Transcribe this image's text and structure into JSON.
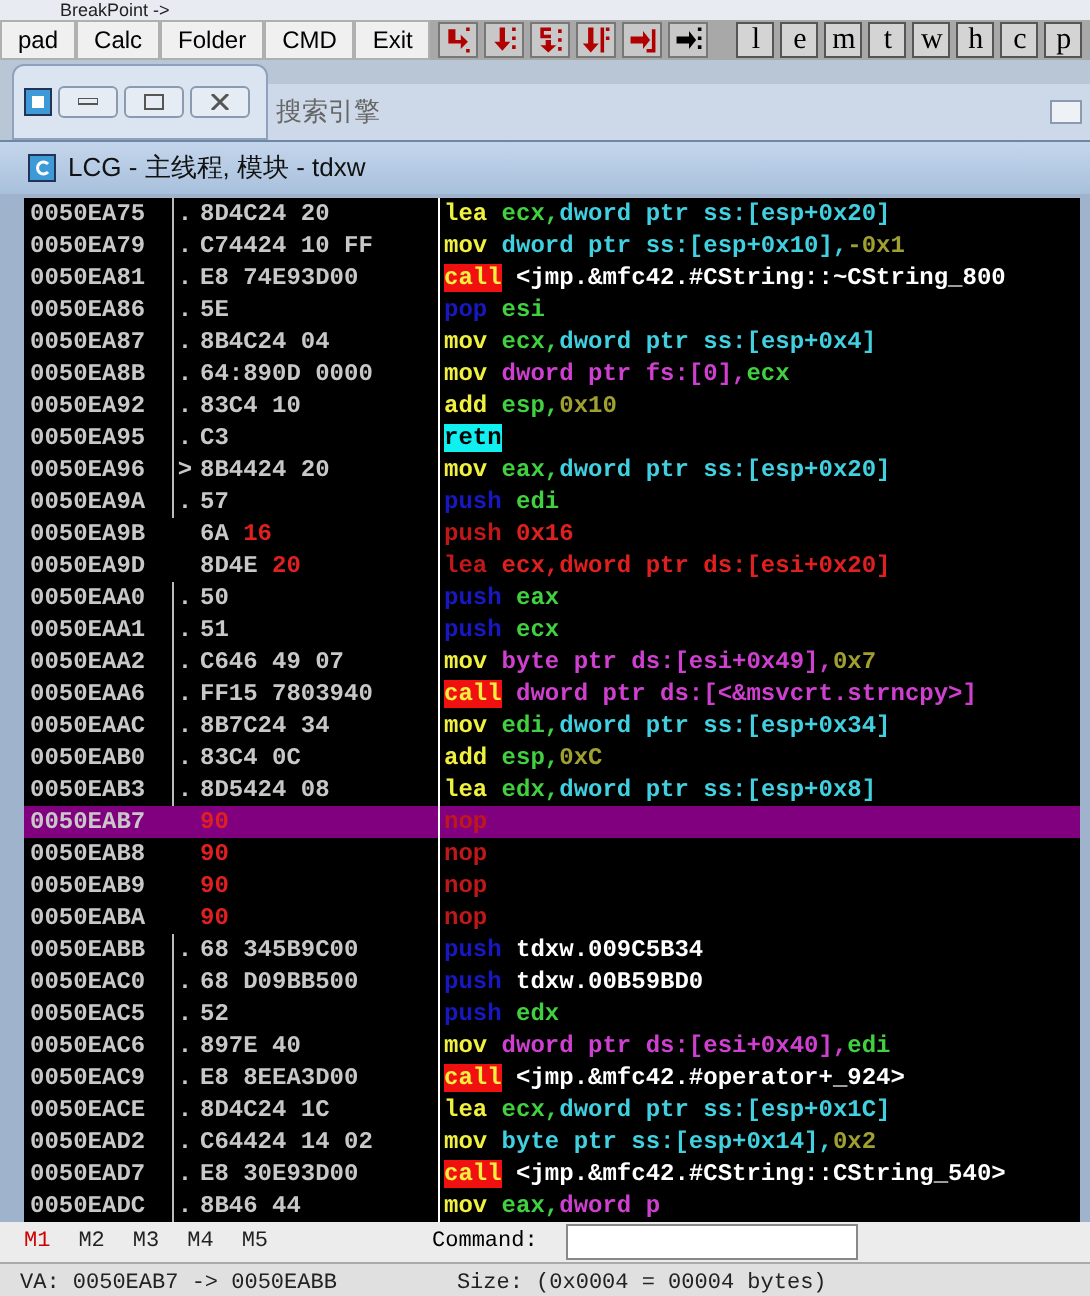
{
  "top_strip": {
    "text": "BreakPoint ->"
  },
  "toolbar": {
    "buttons": [
      "pad",
      "Calc",
      "Folder",
      "CMD",
      "Exit"
    ],
    "letter_buttons": [
      "l",
      "e",
      "m",
      "t",
      "w",
      "h",
      "c",
      "p"
    ]
  },
  "background_window": {
    "title": "搜索引擎"
  },
  "window": {
    "title": "LCG -  主线程, 模块 - tdxw"
  },
  "rows": [
    {
      "address": "0050EA75",
      "marker": ".",
      "bracket": true,
      "selected": false,
      "hex": [
        {
          "text": "8D4C24 20",
          "kind": "plain"
        }
      ],
      "asm": [
        {
          "text": "lea",
          "kind": "op"
        },
        {
          "text": " ecx,",
          "kind": "reg"
        },
        {
          "text": "dword ptr ss:[esp+0x20]",
          "kind": "mem"
        }
      ]
    },
    {
      "address": "0050EA79",
      "marker": ".",
      "bracket": true,
      "selected": false,
      "hex": [
        {
          "text": "C74424 10 FF",
          "kind": "plain"
        }
      ],
      "asm": [
        {
          "text": "mov",
          "kind": "op"
        },
        {
          "text": " dword ptr ss:[esp+0x10],",
          "kind": "mem"
        },
        {
          "text": "-0x1",
          "kind": "imm"
        }
      ]
    },
    {
      "address": "0050EA81",
      "marker": ".",
      "bracket": true,
      "selected": false,
      "hex": [
        {
          "text": "E8 74E93D00",
          "kind": "plain"
        }
      ],
      "asm": [
        {
          "text": "call",
          "kind": "call"
        },
        {
          "text": " <jmp.&mfc42.#CString::~CString_800",
          "kind": "sym"
        }
      ]
    },
    {
      "address": "0050EA86",
      "marker": ".",
      "bracket": true,
      "selected": false,
      "hex": [
        {
          "text": "5E",
          "kind": "plain"
        }
      ],
      "asm": [
        {
          "text": "pop",
          "kind": "stack"
        },
        {
          "text": " esi",
          "kind": "reg"
        }
      ]
    },
    {
      "address": "0050EA87",
      "marker": ".",
      "bracket": true,
      "selected": false,
      "hex": [
        {
          "text": "8B4C24 04",
          "kind": "plain"
        }
      ],
      "asm": [
        {
          "text": "mov",
          "kind": "op"
        },
        {
          "text": " ecx,",
          "kind": "reg"
        },
        {
          "text": "dword ptr ss:[esp+0x4]",
          "kind": "mem"
        }
      ]
    },
    {
      "address": "0050EA8B",
      "marker": ".",
      "bracket": true,
      "selected": false,
      "hex": [
        {
          "text": "64:890D 0000",
          "kind": "plain"
        }
      ],
      "asm": [
        {
          "text": "mov",
          "kind": "op"
        },
        {
          "text": " dword ptr fs:[0],",
          "kind": "memw"
        },
        {
          "text": "ecx",
          "kind": "reg"
        }
      ]
    },
    {
      "address": "0050EA92",
      "marker": ".",
      "bracket": true,
      "selected": false,
      "hex": [
        {
          "text": "83C4 10",
          "kind": "plain"
        }
      ],
      "asm": [
        {
          "text": "add",
          "kind": "op"
        },
        {
          "text": " esp,",
          "kind": "reg"
        },
        {
          "text": "0x10",
          "kind": "imm"
        }
      ]
    },
    {
      "address": "0050EA95",
      "marker": ".",
      "bracket": true,
      "selected": false,
      "hex": [
        {
          "text": "C3",
          "kind": "plain"
        }
      ],
      "asm": [
        {
          "text": "retn",
          "kind": "retn"
        }
      ]
    },
    {
      "address": "0050EA96",
      "marker": ">",
      "bracket": true,
      "selected": false,
      "hex": [
        {
          "text": "8B4424 20",
          "kind": "plain"
        }
      ],
      "asm": [
        {
          "text": "mov",
          "kind": "op"
        },
        {
          "text": " eax,",
          "kind": "reg"
        },
        {
          "text": "dword ptr ss:[esp+0x20]",
          "kind": "mem"
        }
      ]
    },
    {
      "address": "0050EA9A",
      "marker": ".",
      "bracket": true,
      "selected": false,
      "hex": [
        {
          "text": "57",
          "kind": "plain"
        }
      ],
      "asm": [
        {
          "text": "push",
          "kind": "stack"
        },
        {
          "text": " edi",
          "kind": "reg"
        }
      ]
    },
    {
      "address": "0050EA9B",
      "bracket": false,
      "selected": false,
      "hex": [
        {
          "text": "6A ",
          "kind": "plain"
        },
        {
          "text": "16",
          "kind": "red"
        }
      ],
      "asm": [
        {
          "text": "push",
          "kind": "dead"
        },
        {
          "text": " 0x16",
          "kind": "red"
        }
      ]
    },
    {
      "address": "0050EA9D",
      "bracket": false,
      "selected": false,
      "hex": [
        {
          "text": "8D4E ",
          "kind": "plain"
        },
        {
          "text": "20",
          "kind": "red"
        }
      ],
      "asm": [
        {
          "text": "lea",
          "kind": "dead"
        },
        {
          "text": " ecx,dword ptr ds:[esi+0x20]",
          "kind": "red"
        }
      ]
    },
    {
      "address": "0050EAA0",
      "marker": ".",
      "bracket": true,
      "selected": false,
      "hex": [
        {
          "text": "50",
          "kind": "plain"
        }
      ],
      "asm": [
        {
          "text": "push",
          "kind": "stack"
        },
        {
          "text": " eax",
          "kind": "reg"
        }
      ]
    },
    {
      "address": "0050EAA1",
      "marker": ".",
      "bracket": true,
      "selected": false,
      "hex": [
        {
          "text": "51",
          "kind": "plain"
        }
      ],
      "asm": [
        {
          "text": "push",
          "kind": "stack"
        },
        {
          "text": " ecx",
          "kind": "reg"
        }
      ]
    },
    {
      "address": "0050EAA2",
      "marker": ".",
      "bracket": true,
      "selected": false,
      "hex": [
        {
          "text": "C646 49 07",
          "kind": "plain"
        }
      ],
      "asm": [
        {
          "text": "mov",
          "kind": "op"
        },
        {
          "text": " byte ptr ds:[esi+0x49],",
          "kind": "memw"
        },
        {
          "text": "0x7",
          "kind": "imm"
        }
      ]
    },
    {
      "address": "0050EAA6",
      "marker": ".",
      "bracket": true,
      "selected": false,
      "hex": [
        {
          "text": "FF15 7803940",
          "kind": "plain"
        }
      ],
      "asm": [
        {
          "text": "call",
          "kind": "call"
        },
        {
          "text": " dword ptr ds:[<&msvcrt.strncpy>]",
          "kind": "memw"
        }
      ]
    },
    {
      "address": "0050EAAC",
      "marker": ".",
      "bracket": true,
      "selected": false,
      "hex": [
        {
          "text": "8B7C24 34",
          "kind": "plain"
        }
      ],
      "asm": [
        {
          "text": "mov",
          "kind": "op"
        },
        {
          "text": " edi,",
          "kind": "reg"
        },
        {
          "text": "dword ptr ss:[esp+0x34]",
          "kind": "mem"
        }
      ]
    },
    {
      "address": "0050EAB0",
      "marker": ".",
      "bracket": true,
      "selected": false,
      "hex": [
        {
          "text": "83C4 0C",
          "kind": "plain"
        }
      ],
      "asm": [
        {
          "text": "add",
          "kind": "op"
        },
        {
          "text": " esp,",
          "kind": "reg"
        },
        {
          "text": "0xC",
          "kind": "imm"
        }
      ]
    },
    {
      "address": "0050EAB3",
      "marker": ".",
      "bracket": true,
      "selected": false,
      "hex": [
        {
          "text": "8D5424 08",
          "kind": "plain"
        }
      ],
      "asm": [
        {
          "text": "lea",
          "kind": "op"
        },
        {
          "text": " edx,",
          "kind": "reg"
        },
        {
          "text": "dword ptr ss:[esp+0x8]",
          "kind": "mem"
        }
      ]
    },
    {
      "address": "0050EAB7",
      "bracket": false,
      "selected": true,
      "hex": [
        {
          "text": "90",
          "kind": "red"
        }
      ],
      "asm": [
        {
          "text": "nop",
          "kind": "dead"
        }
      ]
    },
    {
      "address": "0050EAB8",
      "bracket": false,
      "selected": false,
      "hex": [
        {
          "text": "90",
          "kind": "red"
        }
      ],
      "asm": [
        {
          "text": "nop",
          "kind": "dead"
        }
      ]
    },
    {
      "address": "0050EAB9",
      "bracket": false,
      "selected": false,
      "hex": [
        {
          "text": "90",
          "kind": "red"
        }
      ],
      "asm": [
        {
          "text": "nop",
          "kind": "dead"
        }
      ]
    },
    {
      "address": "0050EABA",
      "bracket": false,
      "selected": false,
      "hex": [
        {
          "text": "90",
          "kind": "red"
        }
      ],
      "asm": [
        {
          "text": "nop",
          "kind": "dead"
        }
      ]
    },
    {
      "address": "0050EABB",
      "marker": ".",
      "bracket": true,
      "selected": false,
      "hex": [
        {
          "text": "68 345B9C00",
          "kind": "plain"
        }
      ],
      "asm": [
        {
          "text": "push",
          "kind": "stack"
        },
        {
          "text": " tdxw.009C5B34",
          "kind": "sym"
        }
      ]
    },
    {
      "address": "0050EAC0",
      "marker": ".",
      "bracket": true,
      "selected": false,
      "hex": [
        {
          "text": "68 D09BB500",
          "kind": "plain"
        }
      ],
      "asm": [
        {
          "text": "push",
          "kind": "stack"
        },
        {
          "text": " tdxw.00B59BD0",
          "kind": "sym"
        }
      ]
    },
    {
      "address": "0050EAC5",
      "marker": ".",
      "bracket": true,
      "selected": false,
      "hex": [
        {
          "text": "52",
          "kind": "plain"
        }
      ],
      "asm": [
        {
          "text": "push",
          "kind": "stack"
        },
        {
          "text": " edx",
          "kind": "reg"
        }
      ]
    },
    {
      "address": "0050EAC6",
      "marker": ".",
      "bracket": true,
      "selected": false,
      "hex": [
        {
          "text": "897E 40",
          "kind": "plain"
        }
      ],
      "asm": [
        {
          "text": "mov",
          "kind": "op"
        },
        {
          "text": " dword ptr ds:[esi+0x40],",
          "kind": "memw"
        },
        {
          "text": "edi",
          "kind": "reg"
        }
      ]
    },
    {
      "address": "0050EAC9",
      "marker": ".",
      "bracket": true,
      "selected": false,
      "hex": [
        {
          "text": "E8 8EEA3D00",
          "kind": "plain"
        }
      ],
      "asm": [
        {
          "text": "call",
          "kind": "call"
        },
        {
          "text": " <jmp.&mfc42.#operator+_924>",
          "kind": "sym"
        }
      ]
    },
    {
      "address": "0050EACE",
      "marker": ".",
      "bracket": true,
      "selected": false,
      "hex": [
        {
          "text": "8D4C24 1C",
          "kind": "plain"
        }
      ],
      "asm": [
        {
          "text": "lea",
          "kind": "op"
        },
        {
          "text": " ecx,",
          "kind": "reg"
        },
        {
          "text": "dword ptr ss:[esp+0x1C]",
          "kind": "mem"
        }
      ]
    },
    {
      "address": "0050EAD2",
      "marker": ".",
      "bracket": true,
      "selected": false,
      "hex": [
        {
          "text": "C64424 14 02",
          "kind": "plain"
        }
      ],
      "asm": [
        {
          "text": "mov",
          "kind": "op"
        },
        {
          "text": " byte ptr ss:[esp+0x14],",
          "kind": "mem"
        },
        {
          "text": "0x2",
          "kind": "imm"
        }
      ]
    },
    {
      "address": "0050EAD7",
      "marker": ".",
      "bracket": true,
      "selected": false,
      "hex": [
        {
          "text": "E8 30E93D00",
          "kind": "plain"
        }
      ],
      "asm": [
        {
          "text": "call",
          "kind": "call"
        },
        {
          "text": " <jmp.&mfc42.#CString::CString_540>",
          "kind": "sym"
        }
      ]
    },
    {
      "address": "0050EADC",
      "marker": ".",
      "bracket": true,
      "selected": false,
      "hex": [
        {
          "text": "8B46 44",
          "kind": "plain"
        }
      ],
      "asm": [
        {
          "text": "mov",
          "kind": "op"
        },
        {
          "text": " eax,",
          "kind": "reg"
        },
        {
          "text": "dword p",
          "kind": "memw"
        }
      ]
    }
  ],
  "memory_tabs": [
    {
      "label": "M1",
      "selected": true
    },
    {
      "label": "M2",
      "selected": false
    },
    {
      "label": "M3",
      "selected": false
    },
    {
      "label": "M4",
      "selected": false
    },
    {
      "label": "M5",
      "selected": false
    }
  ],
  "command": {
    "label": "Command:"
  },
  "status_bar": {
    "address_range": "VA: 0050EAB7 -> 0050EABB",
    "size": "Size: (0x0004 = 00004 bytes)"
  }
}
